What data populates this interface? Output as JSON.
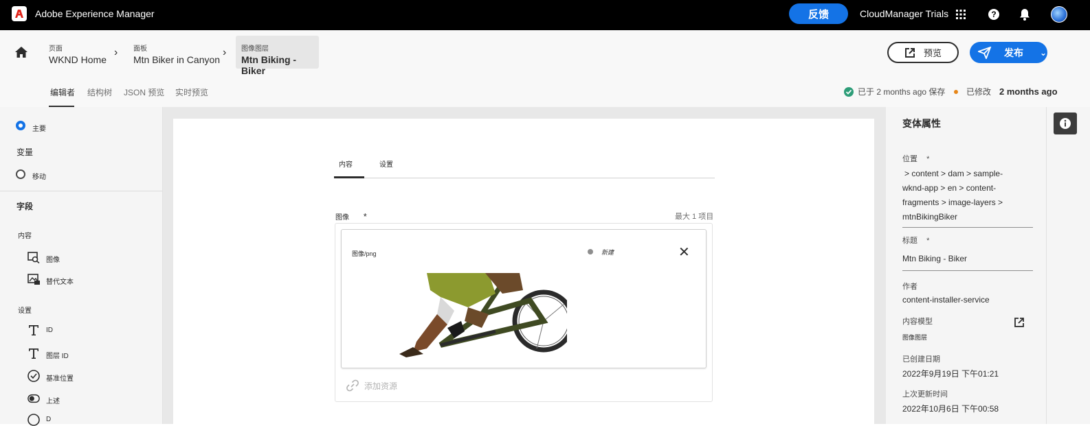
{
  "app": {
    "title": "Adobe Experience Manager",
    "feedback": "反馈",
    "org": "CloudManager Trials"
  },
  "breadcrumb": [
    {
      "small": "页面",
      "big": "WKND Home"
    },
    {
      "small": "面板",
      "big": "Mtn Biker in Canyon"
    },
    {
      "small": "图像图层",
      "big": "Mtn Biking - Biker"
    }
  ],
  "actions": {
    "preview": "预览",
    "publish": "发布"
  },
  "editor_tabs": [
    "编辑者",
    "结构树",
    "JSON 预览",
    "实时预览"
  ],
  "status": {
    "saved": "已于 2 months ago 保存",
    "modified_label": "已修改",
    "modified_value": "2 months ago",
    "saved_color": "#2d9d78",
    "modified_color": "#e68619"
  },
  "left": {
    "variations_master": "主要",
    "variations_heading": "变量",
    "variation_mobile": "移动",
    "fields_heading": "字段",
    "group_content": "内容",
    "field_image": "图像",
    "field_alt": "替代文本",
    "group_settings": "设置",
    "field_id": "ID",
    "field_layer_id": "图层 ID",
    "field_position": "基准位置",
    "field_top": "上述",
    "field_partial": "D"
  },
  "content": {
    "tab_content": "内容",
    "tab_settings": "设置",
    "image_label": "图像",
    "required": "*",
    "max_items": "最大 1 项目",
    "mime": "图像/png",
    "new_status": "新建",
    "add_asset": "添加资源"
  },
  "right": {
    "title": "变体属性",
    "location_label": "位置",
    "location_lines": [
      "> content > dam > sample-",
      "wknd-app > en > content-",
      "fragments > image-layers >",
      "mtnBikingBiker"
    ],
    "title_label": "标题",
    "title_value": "Mtn Biking - Biker",
    "author_label": "作者",
    "author_value": "content-installer-service",
    "model_label": "内容模型",
    "model_value": "图像图层",
    "created_label": "已创建日期",
    "created_value": "2022年9月19日 下午01:21",
    "updated_label": "上次更新时间",
    "updated_value": "2022年10月6日 下午00:58"
  }
}
